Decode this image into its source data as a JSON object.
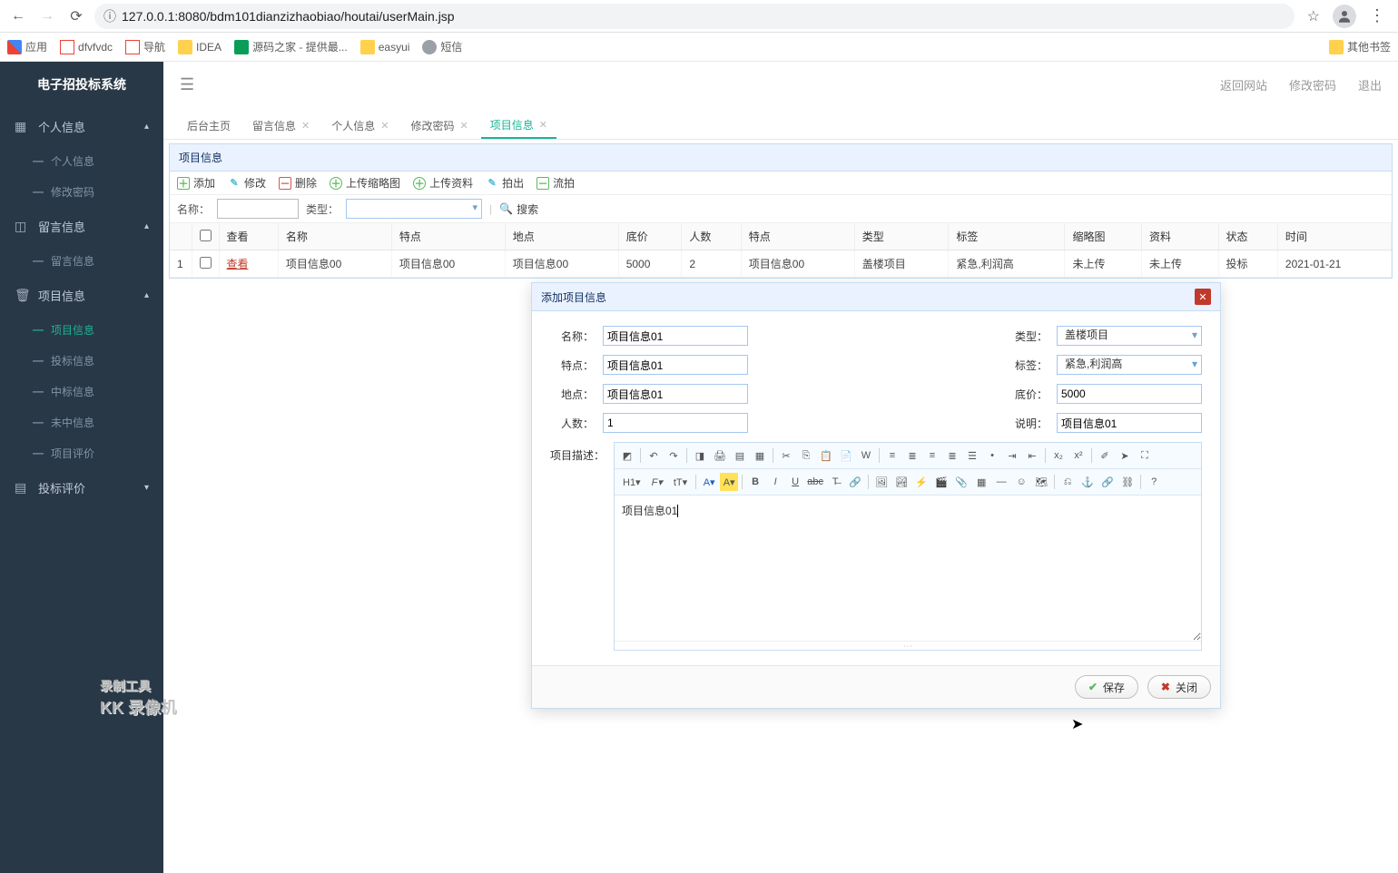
{
  "browser": {
    "url": "127.0.0.1:8080/bdm101dianzizhaobiao/houtai/userMain.jsp",
    "bookmarks": {
      "apps": "应用",
      "items": [
        "dfvfvdc",
        "导航",
        "IDEA",
        "源码之家 - 提供最...",
        "easyui",
        "短信"
      ],
      "other": "其他书签"
    }
  },
  "brand": "电子招投标系统",
  "sidebar": {
    "groups": [
      {
        "title": "个人信息",
        "items": [
          "个人信息",
          "修改密码"
        ]
      },
      {
        "title": "留言信息",
        "items": [
          "留言信息"
        ]
      },
      {
        "title": "项目信息",
        "items": [
          "项目信息",
          "投标信息",
          "中标信息",
          "未中信息",
          "项目评价"
        ]
      },
      {
        "title": "投标评价",
        "items": []
      }
    ]
  },
  "topbar": {
    "back": "返回网站",
    "pwd": "修改密码",
    "logout": "退出"
  },
  "tabs": {
    "items": [
      {
        "label": "后台主页",
        "closable": false
      },
      {
        "label": "留言信息",
        "closable": true
      },
      {
        "label": "个人信息",
        "closable": true
      },
      {
        "label": "修改密码",
        "closable": true
      },
      {
        "label": "项目信息",
        "closable": true,
        "active": true
      }
    ]
  },
  "panel": {
    "title": "项目信息",
    "toolbar": {
      "add": "添加",
      "edit": "修改",
      "del": "删除",
      "thumb": "上传缩略图",
      "material": "上传资料",
      "auction": "拍出",
      "flow": "流拍"
    },
    "search": {
      "name_label": "名称：",
      "type_label": "类型：",
      "btn": "搜索"
    },
    "columns": [
      "",
      "",
      "查看",
      "名称",
      "特点",
      "地点",
      "底价",
      "人数",
      "特点",
      "类型",
      "标签",
      "缩略图",
      "资料",
      "状态",
      "时间"
    ],
    "rows": [
      {
        "idx": "1",
        "view": "查看",
        "name": "项目信息00",
        "feat": "项目信息00",
        "loc": "项目信息00",
        "price": "5000",
        "people": "2",
        "feat2": "项目信息00",
        "type": "盖楼项目",
        "tag": "紧急,利润高",
        "thumb": "未上传",
        "material": "未上传",
        "status": "投标",
        "time": "2021-01-21"
      }
    ]
  },
  "dialog": {
    "title": "添加项目信息",
    "fields": {
      "name_label": "名称：",
      "name_val": "项目信息01",
      "type_label": "类型：",
      "type_val": "盖楼项目",
      "feat_label": "特点：",
      "feat_val": "项目信息01",
      "tag_label": "标签：",
      "tag_val": "紧急,利润高",
      "loc_label": "地点：",
      "loc_val": "项目信息01",
      "price_label": "底价：",
      "price_val": "5000",
      "people_label": "人数：",
      "people_val": "1",
      "desc_label": "说明：",
      "desc_val": "项目信息01",
      "detail_label": "项目描述：",
      "detail_val": "项目信息01"
    },
    "buttons": {
      "save": "保存",
      "close": "关闭"
    }
  },
  "watermark": {
    "line1": "录制工具",
    "line2": "KK 录像机"
  }
}
